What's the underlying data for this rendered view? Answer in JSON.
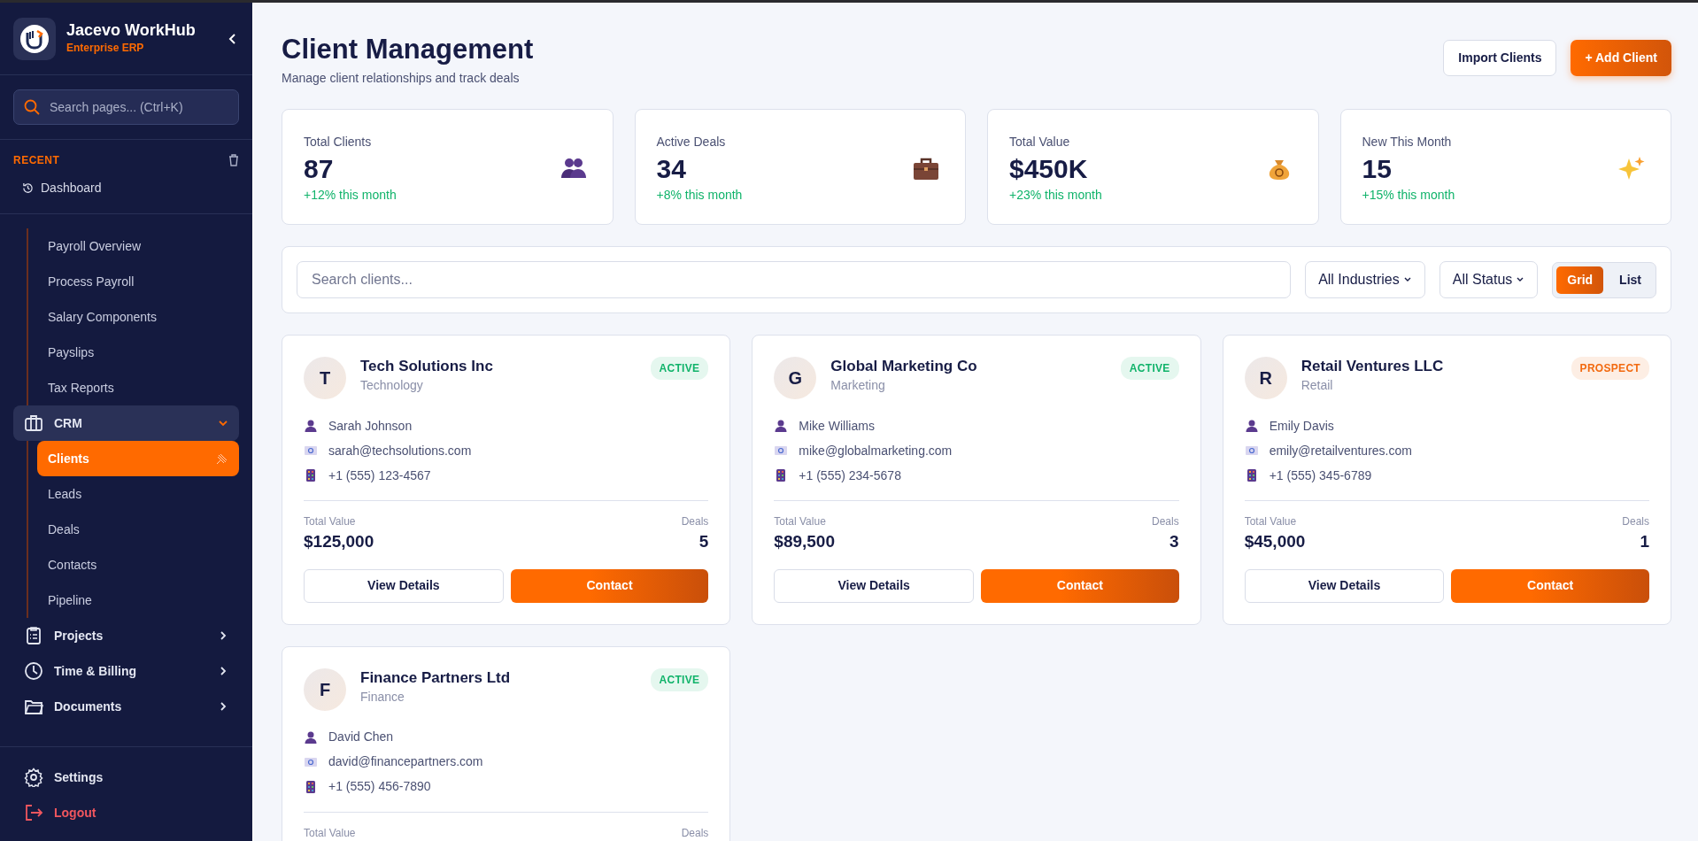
{
  "sidebar": {
    "brand": {
      "name": "Jacevo WorkHub",
      "subtitle": "Enterprise ERP"
    },
    "search": {
      "placeholder": "Search pages... (Ctrl+K)"
    },
    "recent": {
      "title": "RECENT",
      "items": [
        {
          "label": "Dashboard"
        }
      ]
    },
    "scrolled_group_children": [
      {
        "label": "Payroll Overview",
        "selected": false
      },
      {
        "label": "Process Payroll",
        "selected": false
      },
      {
        "label": "Salary Components",
        "selected": false
      },
      {
        "label": "Payslips",
        "selected": false
      },
      {
        "label": "Tax Reports",
        "selected": false
      }
    ],
    "nav": [
      {
        "label": "CRM",
        "expanded": true,
        "children": [
          {
            "label": "Clients",
            "selected": true
          },
          {
            "label": "Leads",
            "selected": false
          },
          {
            "label": "Deals",
            "selected": false
          },
          {
            "label": "Contacts",
            "selected": false
          },
          {
            "label": "Pipeline",
            "selected": false
          }
        ]
      },
      {
        "label": "Projects",
        "expanded": false
      },
      {
        "label": "Time & Billing",
        "expanded": false
      },
      {
        "label": "Documents",
        "expanded": false
      }
    ],
    "footer": [
      {
        "label": "Settings",
        "kind": "normal"
      },
      {
        "label": "Logout",
        "kind": "danger"
      }
    ]
  },
  "header": {
    "title": "Client Management",
    "subtitle": "Manage client relationships and track deals",
    "buttons": [
      {
        "label": "Import Clients",
        "kind": "secondary"
      },
      {
        "label": "+ Add Client",
        "kind": "primary"
      }
    ]
  },
  "stats": [
    {
      "label": "Total Clients",
      "value": "87",
      "change": "+12% this month"
    },
    {
      "label": "Active Deals",
      "value": "34",
      "change": "+8% this month"
    },
    {
      "label": "Total Value",
      "value": "$450K",
      "change": "+23% this month"
    },
    {
      "label": "New This Month",
      "value": "15",
      "change": "+15% this month"
    }
  ],
  "filters": {
    "search": {
      "placeholder": "Search clients..."
    },
    "selects": [
      {
        "value": "All Industries"
      },
      {
        "value": "All Status"
      }
    ],
    "view": [
      {
        "label": "Grid",
        "selected": true
      },
      {
        "label": "List",
        "selected": false
      }
    ]
  },
  "clients": [
    {
      "initial": "T",
      "name": "Tech Solutions Inc",
      "industry": "Technology",
      "status": {
        "label": "ACTIVE",
        "kind": "active"
      },
      "contact": "Sarah Johnson",
      "email": "sarah@techsolutions.com",
      "phone": "+1 (555) 123-4567",
      "value_label": "Total Value",
      "value": "$125,000",
      "deals_label": "Deals",
      "deals": "5",
      "buttons": [
        "View Details",
        "Contact"
      ]
    },
    {
      "initial": "G",
      "name": "Global Marketing Co",
      "industry": "Marketing",
      "status": {
        "label": "ACTIVE",
        "kind": "active"
      },
      "contact": "Mike Williams",
      "email": "mike@globalmarketing.com",
      "phone": "+1 (555) 234-5678",
      "value_label": "Total Value",
      "value": "$89,500",
      "deals_label": "Deals",
      "deals": "3",
      "buttons": [
        "View Details",
        "Contact"
      ]
    },
    {
      "initial": "R",
      "name": "Retail Ventures LLC",
      "industry": "Retail",
      "status": {
        "label": "PROSPECT",
        "kind": "prospect"
      },
      "contact": "Emily Davis",
      "email": "emily@retailventures.com",
      "phone": "+1 (555) 345-6789",
      "value_label": "Total Value",
      "value": "$45,000",
      "deals_label": "Deals",
      "deals": "1",
      "buttons": [
        "View Details",
        "Contact"
      ]
    },
    {
      "initial": "F",
      "name": "Finance Partners Ltd",
      "industry": "Finance",
      "status": {
        "label": "ACTIVE",
        "kind": "active"
      },
      "contact": "David Chen",
      "email": "david@financepartners.com",
      "phone": "+1 (555) 456-7890",
      "value_label": "Total Value",
      "deals_label": "Deals"
    }
  ]
}
